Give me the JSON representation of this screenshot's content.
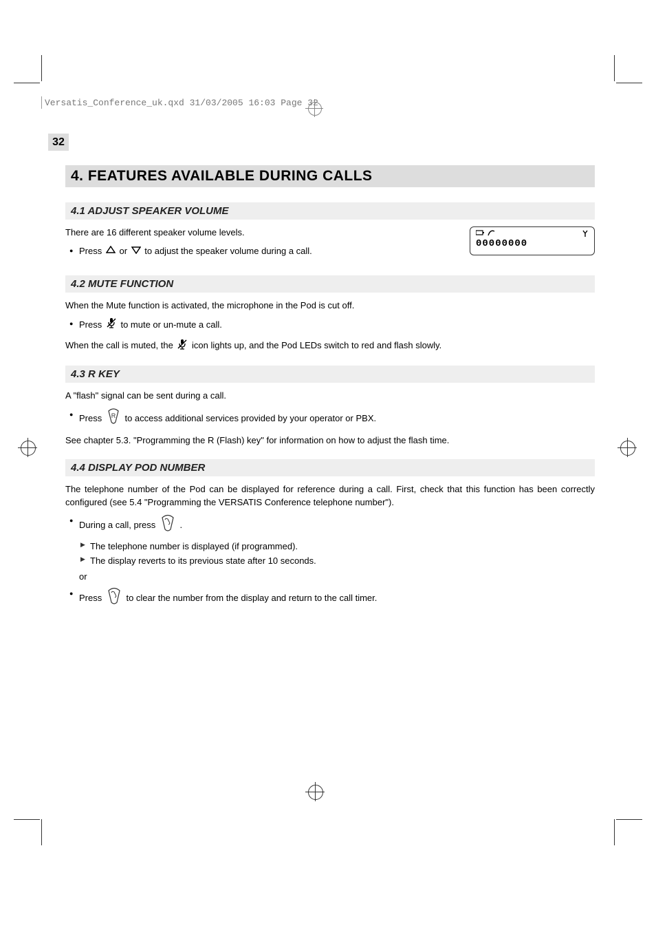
{
  "header_stamp": "Versatis_Conference_uk.qxd  31/03/2005  16:03  Page 32",
  "page_number": "32",
  "chapter_heading": "4.   FEATURES AVAILABLE DURING CALLS",
  "lcd": {
    "readout": "00000000"
  },
  "s41": {
    "heading": "4.1   ADJUST SPEAKER VOLUME",
    "p1": "There are 16 different speaker volume levels.",
    "b1_pre": "Press ",
    "b1_mid": " or ",
    "b1_post": " to adjust the speaker volume during a call."
  },
  "s42": {
    "heading": "4.2   MUTE FUNCTION",
    "p1": "When the Mute function is activated, the microphone in the Pod is cut off.",
    "b1_pre": "Press ",
    "b1_post": " to mute or un-mute a call.",
    "p2_pre": "When the call is muted, the ",
    "p2_post": " icon lights up, and the Pod LEDs switch to red and flash slowly."
  },
  "s43": {
    "heading": "4.3   R KEY",
    "p1": "A \"flash\" signal can be sent during a call.",
    "b1_pre": "Press ",
    "b1_post": " to access additional services provided by your operator or PBX.",
    "p2": "See chapter 5.3. \"Programming the R (Flash) key\" for information on how to adjust the flash time."
  },
  "s44": {
    "heading": "4.4   DISPLAY POD NUMBER",
    "p1": "The telephone number of the Pod can be displayed for reference during a call. First, check that this function has been correctly configured (see 5.4 \"Programming the VERSATIS Conference telephone number\").",
    "b1_pre": "During a call, press ",
    "b1_post": ".",
    "sub1": "The telephone number is displayed (if programmed).",
    "sub2": "The display reverts to its previous state after 10 seconds.",
    "or": "or",
    "b2_pre": "Press ",
    "b2_post": " to clear the number from the display and return to the call timer."
  }
}
